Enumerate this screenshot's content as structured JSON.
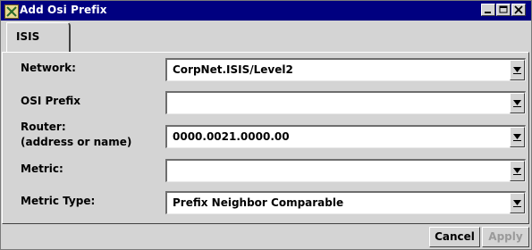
{
  "window": {
    "title": "Add Osi Prefix",
    "title_bg": "#000080"
  },
  "tabs": [
    {
      "label": "ISIS",
      "active": true
    }
  ],
  "form": {
    "rows": [
      {
        "label": "Network:",
        "value": "CorpNet.ISIS/Level2"
      },
      {
        "label": "OSI Prefix",
        "value": ""
      },
      {
        "label": "Router:",
        "label_line2": "(address or name)",
        "value": "0000.0021.0000.00"
      },
      {
        "label": "Metric:",
        "value": ""
      },
      {
        "label": "Metric Type:",
        "value": "Prefix Neighbor Comparable"
      }
    ]
  },
  "footer": {
    "cancel_label": "Cancel",
    "apply_label": "Apply",
    "apply_enabled": false
  },
  "icons": {
    "app": "app-icon",
    "minimize": "minimize-icon",
    "maximize": "maximize-icon",
    "close": "close-icon",
    "dropdown": "chevron-down-icon"
  }
}
